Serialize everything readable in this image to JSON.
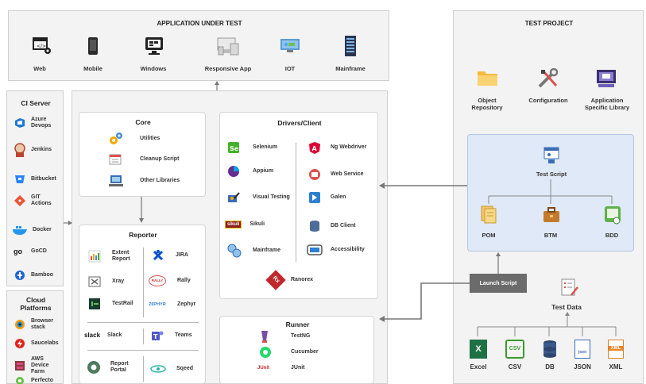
{
  "aut": {
    "title": "APPLICATION UNDER TEST",
    "items": [
      "Web",
      "Mobile",
      "Windows",
      "Responsive App",
      "IOT",
      "Mainframe"
    ]
  },
  "ci": {
    "title": "CI Server",
    "items": [
      "Azure Devops",
      "Jenkins",
      "Bitbucket",
      "GIT Actions",
      "Docker",
      "GoCD",
      "Bamboo"
    ],
    "gocd_logo": "go"
  },
  "cloud": {
    "title": "Cloud Platforms",
    "items": [
      "Browser stack",
      "Saucelabs",
      "AWS Device Farm",
      "Perfecto"
    ]
  },
  "core": {
    "title": "Core",
    "items": [
      "Utilities",
      "Cleanup Script",
      "Other Libraries"
    ]
  },
  "drivers": {
    "title": "Drivers/Client",
    "left": [
      "Selenium",
      "Appium",
      "Visual Testing",
      "Sikuli",
      "Mainframe"
    ],
    "right": [
      "Ng Webdriver",
      "Web Service",
      "Galen",
      "DB Client",
      "Accessibility"
    ],
    "bottom": "Ranorex",
    "sikuli_logo": "sikuli",
    "ranorex_logo": "Rx"
  },
  "reporter": {
    "title": "Reporter",
    "left": [
      "Extent Report",
      "Xray",
      "TestRail"
    ],
    "right": [
      "JIRA",
      "Rally",
      "Zephyr"
    ],
    "slack_logo": "slack",
    "slack": "Slack",
    "teams": "Teams",
    "report_portal": "Report Portal",
    "sqeed": "Sqeed",
    "rally_logo": "RALLY",
    "zephyr_logo": "Z€PHYR"
  },
  "runner": {
    "title": "Runner",
    "items": [
      "TestNG",
      "Cucumber",
      "JUnit"
    ],
    "junit_logo": "JUnit"
  },
  "project": {
    "title": "TEST PROJECT",
    "top": [
      "Object Repository",
      "Configuration",
      "Application Specific Library"
    ],
    "test_script": "Test Script",
    "models": [
      "POM",
      "BTM",
      "BDD"
    ],
    "launch": "Launch Script",
    "test_data": "Test Data",
    "formats": [
      "Excel",
      "CSV",
      "DB",
      "JSON",
      "XML"
    ],
    "format_marks": [
      "X",
      "CSV",
      "",
      "json",
      "XML"
    ]
  },
  "colors": {
    "panel": "#f3f3f3",
    "blue_panel": "#dfe9f7",
    "launch": "#6b6b6b",
    "arrow": "#777777"
  }
}
